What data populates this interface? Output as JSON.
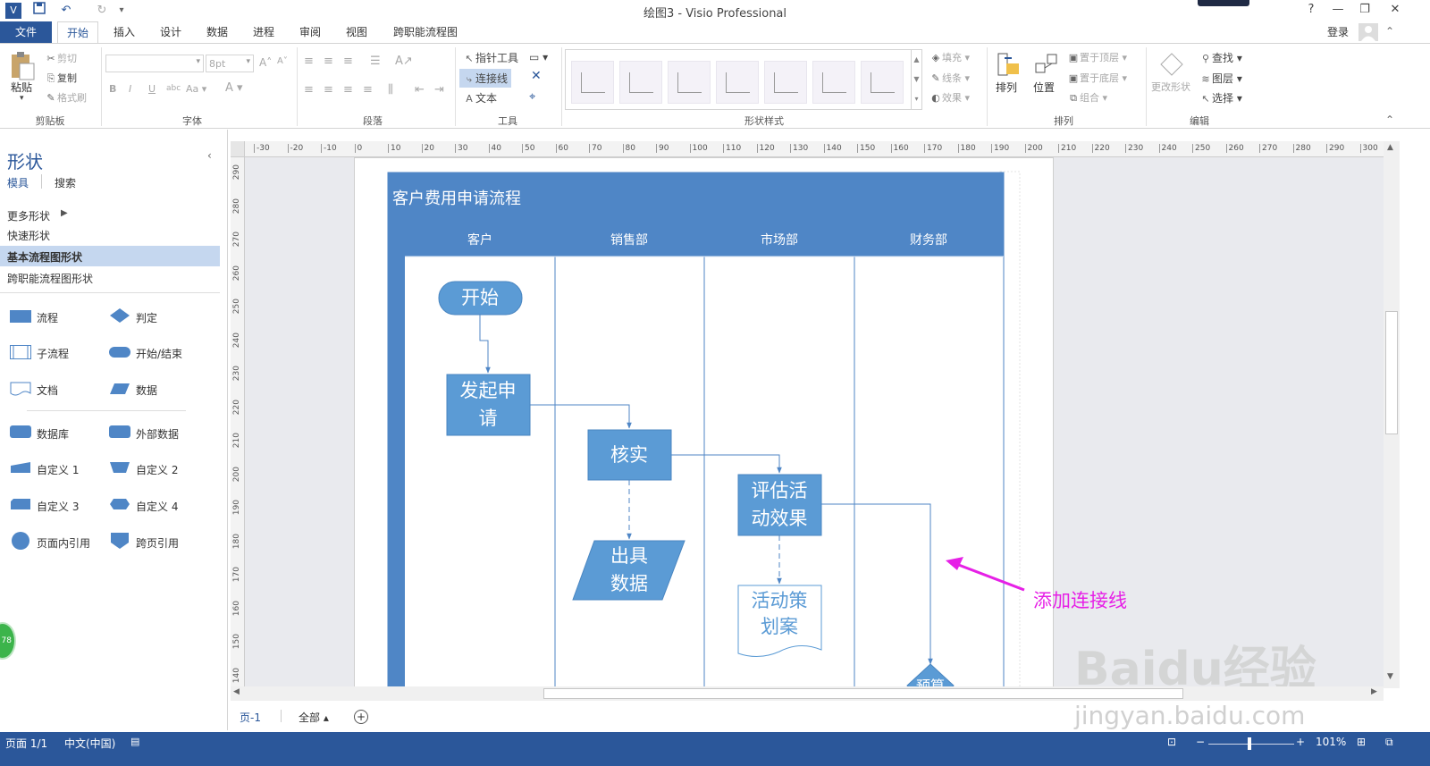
{
  "window": {
    "title": "绘图3 - Visio Professional",
    "login": "登录"
  },
  "tabs": [
    "文件",
    "开始",
    "插入",
    "设计",
    "数据",
    "进程",
    "审阅",
    "视图",
    "跨职能流程图"
  ],
  "ribbon": {
    "clipboard": {
      "paste": "粘贴",
      "cut": "剪切",
      "copy": "复制",
      "format_painter": "格式刷",
      "label": "剪贴板"
    },
    "font": {
      "size": "8pt",
      "label": "字体"
    },
    "paragraph": {
      "label": "段落"
    },
    "tools": {
      "pointer": "指针工具",
      "connector": "连接线",
      "text": "文本",
      "label": "工具"
    },
    "shape_styles": {
      "fill": "填充",
      "line": "线条",
      "effects": "效果",
      "label": "形状样式"
    },
    "arrange": {
      "arrange": "排列",
      "position": "位置",
      "bring_front": "置于顶层",
      "send_back": "置于底层",
      "group": "组合",
      "label": "排列"
    },
    "editing": {
      "change_shape": "更改形状",
      "find": "查找",
      "layers": "图层",
      "select": "选择",
      "label": "编辑"
    }
  },
  "panel": {
    "title": "形状",
    "tab_stencil": "模具",
    "tab_search": "搜索",
    "menu": [
      "更多形状",
      "快速形状",
      "基本流程图形状",
      "跨职能流程图形状"
    ],
    "shapes": [
      "流程",
      "判定",
      "子流程",
      "开始/结束",
      "文档",
      "数据",
      "数据库",
      "外部数据",
      "自定义 1",
      "自定义 2",
      "自定义 3",
      "自定义 4",
      "页面内引用",
      "跨页引用"
    ]
  },
  "rulers": {
    "h": [
      "-30",
      "-20",
      "-10",
      "0",
      "10",
      "20",
      "30",
      "40",
      "50",
      "60",
      "70",
      "80",
      "90",
      "100",
      "110",
      "120",
      "130",
      "140",
      "150",
      "160",
      "170",
      "180",
      "190",
      "200",
      "210",
      "220",
      "230",
      "240",
      "250",
      "260",
      "270",
      "280",
      "290",
      "300"
    ],
    "v": [
      "290",
      "280",
      "270",
      "260",
      "250",
      "240",
      "230",
      "220",
      "210",
      "200",
      "190",
      "180",
      "170",
      "160",
      "150",
      "140"
    ]
  },
  "diagram": {
    "title": "客户费用申请流程",
    "lanes": [
      "客户",
      "销售部",
      "市场部",
      "财务部"
    ],
    "start": "开始",
    "submit": "发起申请",
    "verify": "核实",
    "evaluate": "评估活动效果",
    "output": "出具数据",
    "plan": "活动策划案",
    "decision": "预算"
  },
  "annotation": {
    "text": "添加连接线"
  },
  "page_tabs": {
    "page": "页-1",
    "all": "全部"
  },
  "statusbar": {
    "page": "页面 1/1",
    "lang": "中文(中国)",
    "zoom": "101%"
  },
  "badge": "78",
  "watermark": {
    "brand": "Baidu经验",
    "url": "jingyan.baidu.com"
  },
  "colors": {
    "accent": "#2b579a",
    "shape": "#5b9bd5",
    "swimlane": "#4f86c6",
    "annotation": "#e620e6"
  }
}
